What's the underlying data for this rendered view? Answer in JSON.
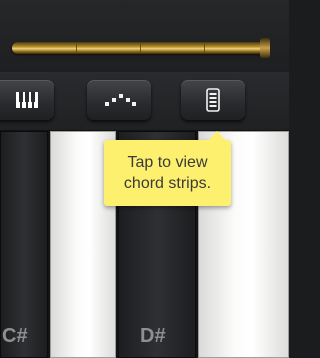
{
  "toolbar": {
    "buttons": [
      {
        "icon": "keyboard-icon"
      },
      {
        "icon": "arpeggiator-icon"
      },
      {
        "icon": "chord-strips-icon"
      }
    ]
  },
  "tooltip": {
    "line1": "Tap to view",
    "line2": "chord strips."
  },
  "keys": {
    "c_sharp_label": "C#",
    "d_sharp_label": "D#"
  },
  "colors": {
    "tooltip_bg": "#fdf06e",
    "gold_rail": "#c9a04a",
    "panel_dark": "#1b1c1e"
  }
}
